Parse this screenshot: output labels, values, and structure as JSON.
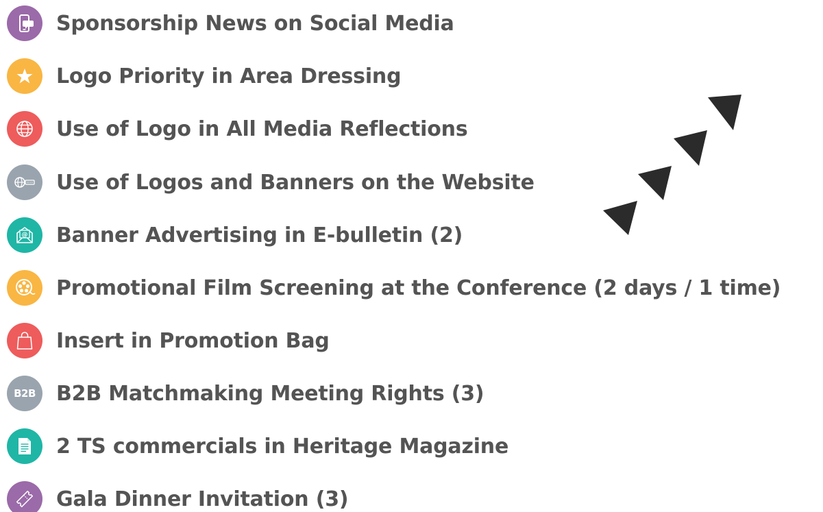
{
  "benefits": {
    "items": [
      {
        "label": "Sponsorship News on Social Media",
        "icon": "phone-chat-icon",
        "color": "#9b6aa9"
      },
      {
        "label": "Logo Priority in Area Dressing",
        "icon": "star-icon",
        "color": "#f9b643"
      },
      {
        "label": "Use of Logo in All Media Reflections",
        "icon": "globe-icon",
        "color": "#ee5c5c"
      },
      {
        "label": "Use of Logos and Banners on the Website",
        "icon": "web-search-icon",
        "color": "#9aa4ae"
      },
      {
        "label": "Banner Advertising in E-bulletin (2)",
        "icon": "email-icon",
        "color": "#1fb6a6"
      },
      {
        "label": "Promotional Film Screening at the Conference (2 days / 1 time)",
        "icon": "film-reel-icon",
        "color": "#f9b643"
      },
      {
        "label": "Insert in Promotion Bag",
        "icon": "bag-icon",
        "color": "#ee5c5c"
      },
      {
        "label": "B2B Matchmaking Meeting Rights (3)",
        "icon": "b2b-icon",
        "icon_text": "B2B",
        "color": "#9aa4ae"
      },
      {
        "label": "2 TS commercials in Heritage Magazine",
        "icon": "document-icon",
        "color": "#1fb6a6"
      },
      {
        "label": "Gala Dinner Invitation (3)",
        "icon": "ticket-icon",
        "color": "#9b6aa9"
      }
    ]
  },
  "decoration": {
    "arrow_color": "#2b2b2b"
  }
}
